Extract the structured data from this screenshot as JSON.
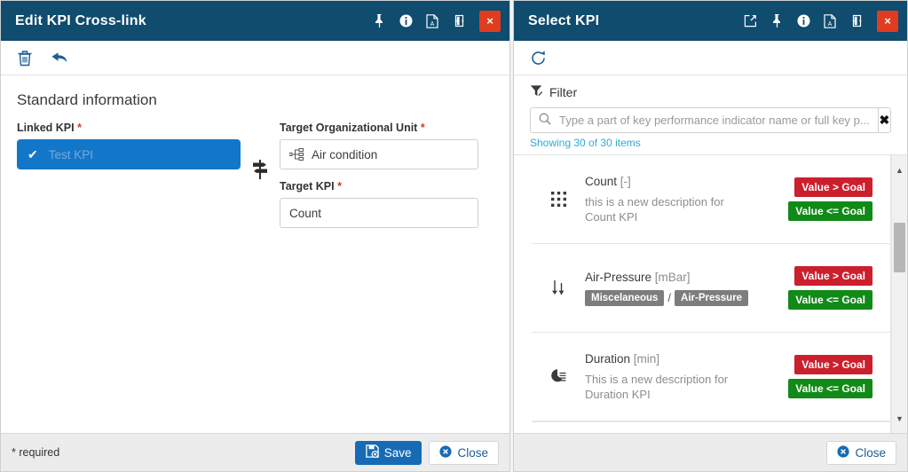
{
  "left_window": {
    "title": "Edit KPI Cross-link",
    "titlebar_icons": [
      {
        "name": "pin-icon",
        "label": "Pin"
      },
      {
        "name": "info-icon",
        "label": "Info"
      },
      {
        "name": "pdf-icon",
        "label": "Export PDF"
      },
      {
        "name": "flip-icon",
        "label": "Flip"
      }
    ],
    "close_label": "×",
    "toolbar": [
      {
        "name": "delete-icon",
        "label": "Delete"
      },
      {
        "name": "undo-icon",
        "label": "Undo"
      }
    ],
    "section_title": "Standard information",
    "linked_kpi": {
      "label": "Linked KPI",
      "required_marker": "*",
      "value": "Test KPI",
      "check_glyph": "✔"
    },
    "link_icon_name": "signpost-icon",
    "target_org_unit": {
      "label": "Target Organizational Unit",
      "required_marker": "*",
      "value": "Air condition",
      "icon": "org-hierarchy-icon"
    },
    "target_kpi": {
      "label": "Target KPI",
      "required_marker": "*",
      "value": "Count"
    },
    "footer": {
      "required_note": "* required",
      "save_label": "Save",
      "close_label": "Close"
    }
  },
  "right_window": {
    "title": "Select KPI",
    "titlebar_icons": [
      {
        "name": "open-external-icon",
        "label": "Open in new window"
      },
      {
        "name": "pin-icon",
        "label": "Pin"
      },
      {
        "name": "info-icon",
        "label": "Info"
      },
      {
        "name": "pdf-icon",
        "label": "Export PDF"
      },
      {
        "name": "flip-icon",
        "label": "Flip"
      }
    ],
    "close_label": "×",
    "toolbar": [
      {
        "name": "refresh-icon",
        "label": "Refresh"
      }
    ],
    "filter": {
      "heading": "Filter",
      "placeholder": "Type a part of key performance indicator name or full key p...",
      "clear_glyph": "✖",
      "showing_text": "Showing 30 of 30 items"
    },
    "kpi_list": [
      {
        "icon": "grid-dots-icon",
        "name": "Count",
        "unit": "[-]",
        "description": "this is a new description for Count KPI",
        "tags": [],
        "badges": [
          {
            "text": "Value > Goal",
            "color": "#cc1f2d"
          },
          {
            "text": "Value <= Goal",
            "color": "#128a18"
          }
        ]
      },
      {
        "icon": "sort-arrows-icon",
        "name": "Air-Pressure",
        "unit": "[mBar]",
        "description": "",
        "tags": [
          "Miscelaneous",
          "Air-Pressure"
        ],
        "tag_separator": "/",
        "badges": [
          {
            "text": "Value > Goal",
            "color": "#cc1f2d"
          },
          {
            "text": "Value <= Goal",
            "color": "#128a18"
          }
        ]
      },
      {
        "icon": "pie-chart-list-icon",
        "name": "Duration",
        "unit": "[min]",
        "description": "This is a new description for Duration KPI",
        "tags": [],
        "badges": [
          {
            "text": "Value > Goal",
            "color": "#cc1f2d"
          },
          {
            "text": "Value <= Goal",
            "color": "#128a18"
          }
        ]
      }
    ],
    "scrollbar": {
      "up_glyph": "▲",
      "down_glyph": "▼"
    },
    "footer": {
      "close_label": "Close"
    }
  },
  "colors": {
    "titlebar": "#0f4c6e",
    "close_red": "#e03c1f",
    "accent_blue": "#1277c9",
    "link_blue": "#1c5d96",
    "badge_red": "#cc1f2d",
    "badge_green": "#128a18",
    "tag_gray": "#7d7d7d",
    "showing_cyan": "#2aace2"
  }
}
